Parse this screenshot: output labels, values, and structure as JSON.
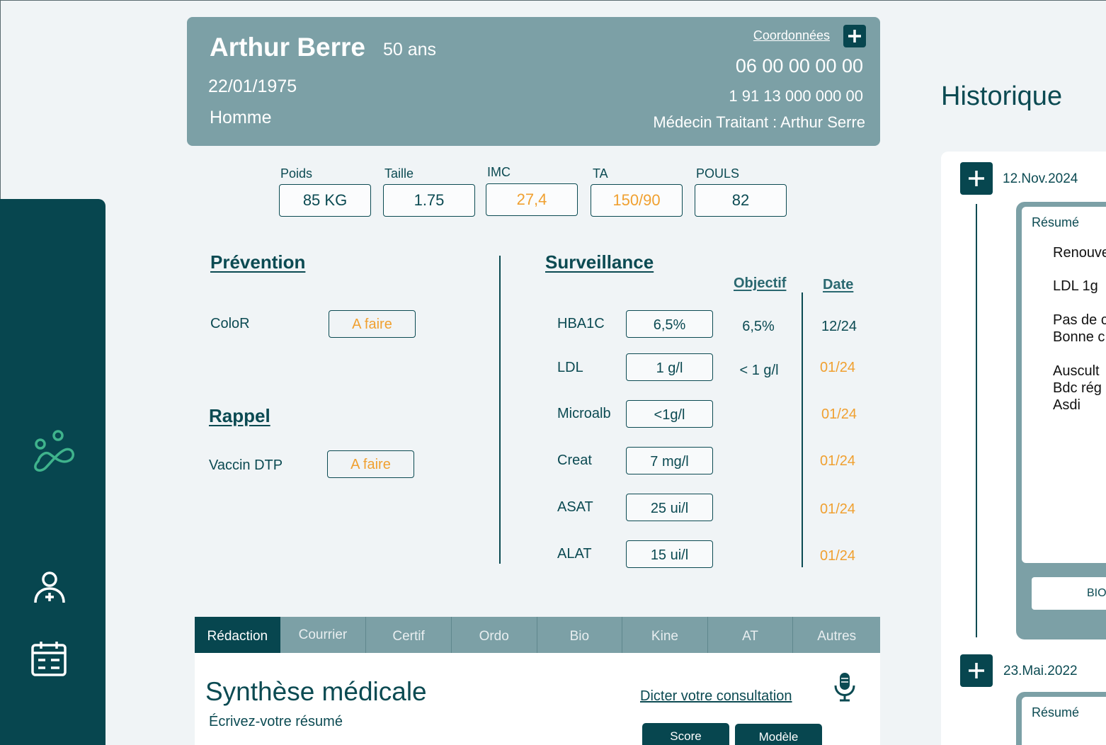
{
  "patient": {
    "name": "Arthur Berre",
    "age": "50 ans",
    "dob": "22/01/1975",
    "sex": "Homme",
    "coordinates_link": "Coordonnées",
    "phone": "06 00 00 00 00",
    "ssn": "1 91 13 000 000 00",
    "doctor": "Médecin Traitant : Arthur Serre"
  },
  "vitals": [
    {
      "label": "Poids",
      "value": "85 KG",
      "warn": false
    },
    {
      "label": "Taille",
      "value": "1.75",
      "warn": false
    },
    {
      "label": "IMC",
      "value": "27,4",
      "warn": true
    },
    {
      "label": "TA",
      "value": "150/90",
      "warn": true
    },
    {
      "label": "POULS",
      "value": "82",
      "warn": false
    }
  ],
  "prevention": {
    "title": "Prévention",
    "items": [
      {
        "label": "ColoR",
        "status": "A faire"
      }
    ]
  },
  "rappel": {
    "title": "Rappel",
    "items": [
      {
        "label": "Vaccin DTP",
        "status": "A faire"
      }
    ]
  },
  "surveillance": {
    "title": "Surveillance",
    "objective_header": "Objectif",
    "date_header": "Date",
    "rows": [
      {
        "label": "HBA1C",
        "value": "6,5%",
        "target": "6,5%",
        "date": "12/24",
        "warn": false
      },
      {
        "label": "LDL",
        "value": "1 g/l",
        "target": "< 1 g/l",
        "date": "01/24",
        "warn": true
      },
      {
        "label": "Microalb",
        "value": "<1g/l",
        "target": "",
        "date": "01/24",
        "warn": true
      },
      {
        "label": "Creat",
        "value": "7 mg/l",
        "target": "",
        "date": "01/24",
        "warn": true
      },
      {
        "label": "ASAT",
        "value": "25 ui/l",
        "target": "",
        "date": "01/24",
        "warn": true
      },
      {
        "label": "ALAT",
        "value": "15 ui/l",
        "target": "",
        "date": "01/24",
        "warn": true
      }
    ]
  },
  "tabs": [
    "Rédaction",
    "Courrier",
    "Certif",
    "Ordo",
    "Bio",
    "Kine",
    "AT",
    "Autres"
  ],
  "editor": {
    "title": "Synthèse médicale",
    "subtitle": "Écrivez-votre résumé",
    "dictate": "Dicter votre consultation",
    "score_button": "Score",
    "model_button": "Modèle"
  },
  "history": {
    "title": "Historique",
    "entries": [
      {
        "date": "12.Nov.2024",
        "summary_label": "Résumé",
        "lines": [
          "Renouve",
          "LDL 1g",
          "Pas de c",
          "Bonne c",
          "Auscult",
          "Bdc rég",
          "Asdi"
        ],
        "bio_label": "BIO"
      },
      {
        "date": "23.Mai.2022",
        "summary_label": "Résumé"
      }
    ]
  },
  "colors": {
    "primary": "#07464f",
    "card": "#7ca0a6",
    "warning": "#f0a030",
    "background": "#f0f4f6",
    "logo": "#3fb38c"
  }
}
